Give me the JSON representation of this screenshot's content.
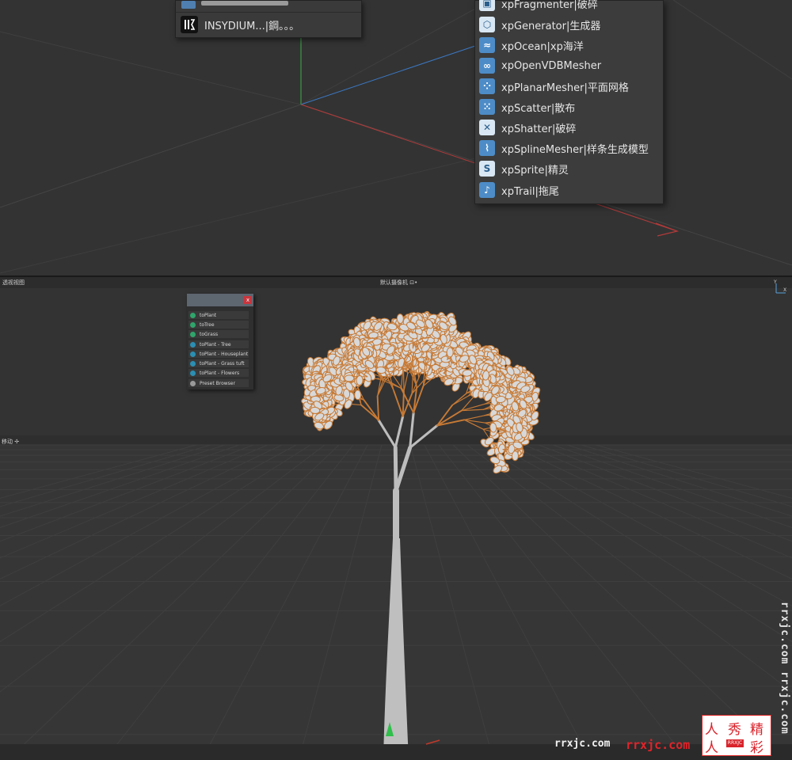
{
  "top_panel": {
    "popup_menu": {
      "item_label": "INSYDIUM...|鋼。。。",
      "item_icon": "insydium-logo-icon"
    },
    "xp_menu": {
      "items": [
        {
          "label": "xpFragmenter|破碎",
          "icon": "xp-fragmenter-icon"
        },
        {
          "label": "xpGenerator|生成器",
          "icon": "xp-generator-icon"
        },
        {
          "label": "xpOcean|xp海洋",
          "icon": "xp-ocean-icon"
        },
        {
          "label": "xpOpenVDBMesher",
          "icon": "xp-openvdb-icon"
        },
        {
          "label": "xpPlanarMesher|平面网格",
          "icon": "xp-planar-mesher-icon"
        },
        {
          "label": "xpScatter|散布",
          "icon": "xp-scatter-icon"
        },
        {
          "label": "xpShatter|破碎",
          "icon": "xp-shatter-icon"
        },
        {
          "label": "xpSplineMesher|样条生成模型",
          "icon": "xp-spline-mesher-icon"
        },
        {
          "label": "xpSprite|精灵",
          "icon": "xp-sprite-icon"
        },
        {
          "label": "xpTrail|拖尾",
          "icon": "xp-trail-icon"
        }
      ]
    }
  },
  "viewport": {
    "title": "透视视图",
    "camera": "默认摄像机 ⊡•",
    "move_hint": "移动 ✢",
    "axis_label_y": "Y",
    "axis_label_x": "X",
    "plant_menu": {
      "close_label": "x",
      "items": [
        {
          "label": "toPlant",
          "icon": "plant-icon"
        },
        {
          "label": "toTree",
          "icon": "tree-icon"
        },
        {
          "label": "toGrass",
          "icon": "grass-icon"
        },
        {
          "label": "toPlant - Tree",
          "icon": "preset-tree-icon"
        },
        {
          "label": "toPlant - Houseplant",
          "icon": "preset-houseplant-icon"
        },
        {
          "label": "toPlant - Grass tuft",
          "icon": "preset-grass-icon"
        },
        {
          "label": "toPlant - Flowers",
          "icon": "preset-flowers-icon"
        },
        {
          "label": "Preset Browser",
          "icon": "preset-browser-icon"
        }
      ]
    }
  },
  "watermarks": {
    "vertical": "rrxjc.com rrxjc.com",
    "white": "rrxjc.com",
    "red": "rrxjc.com",
    "seal_char_1": "人",
    "seal_char_2": "人",
    "seal_char_3": "秀",
    "seal_char_4": "精",
    "seal_char_5": "彩",
    "seal_small": "RRXJC"
  },
  "colors": {
    "accent_blue": "#4d8cc7",
    "leaf_orange": "#c77a35",
    "watermark_red": "#e0242a"
  }
}
